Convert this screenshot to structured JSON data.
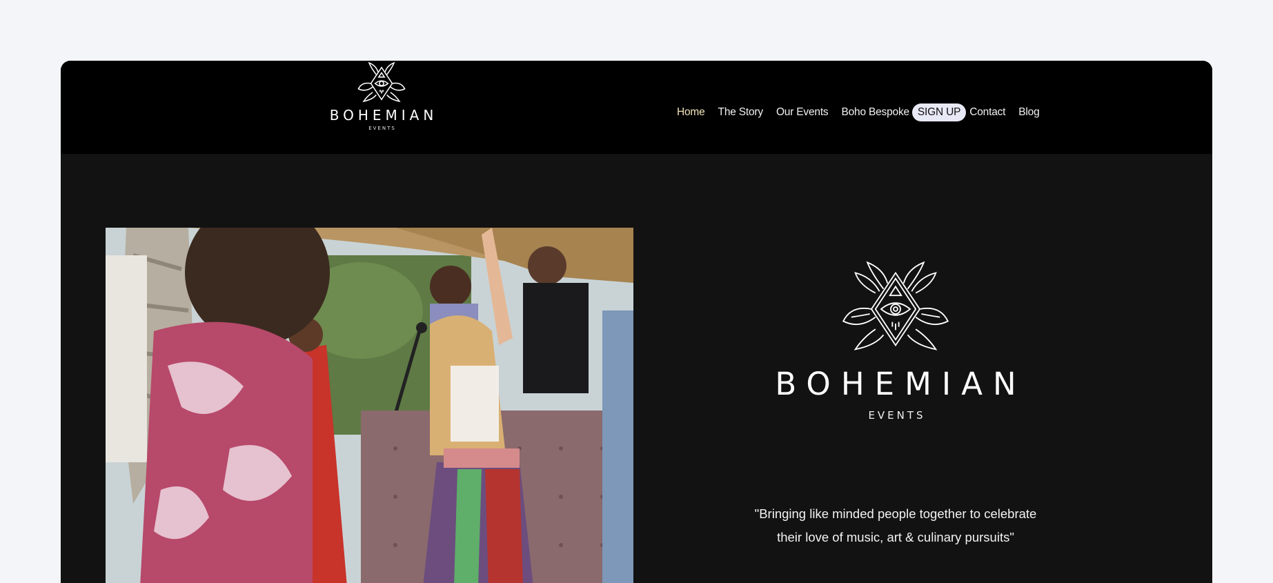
{
  "brand": {
    "name": "BOHEMIAN",
    "sub": "EVENTS"
  },
  "nav": {
    "items": [
      {
        "label": "Home"
      },
      {
        "label": "The Story"
      },
      {
        "label": "Our Events"
      },
      {
        "label": "Boho Bespoke"
      },
      {
        "label": "SIGN UP"
      },
      {
        "label": "Contact"
      },
      {
        "label": "Blog"
      }
    ]
  },
  "hero": {
    "tagline_line1": "\"Bringing like minded people together to celebrate",
    "tagline_line2": "their love of music, art  & culinary pursuits\""
  },
  "colors": {
    "header_bg": "#000000",
    "page_bg": "#121213",
    "active_nav": "#f3e3b8",
    "signup_bg": "#e8e9f6"
  },
  "icons": {
    "logo": "eye-diamond-leaf-emblem"
  }
}
